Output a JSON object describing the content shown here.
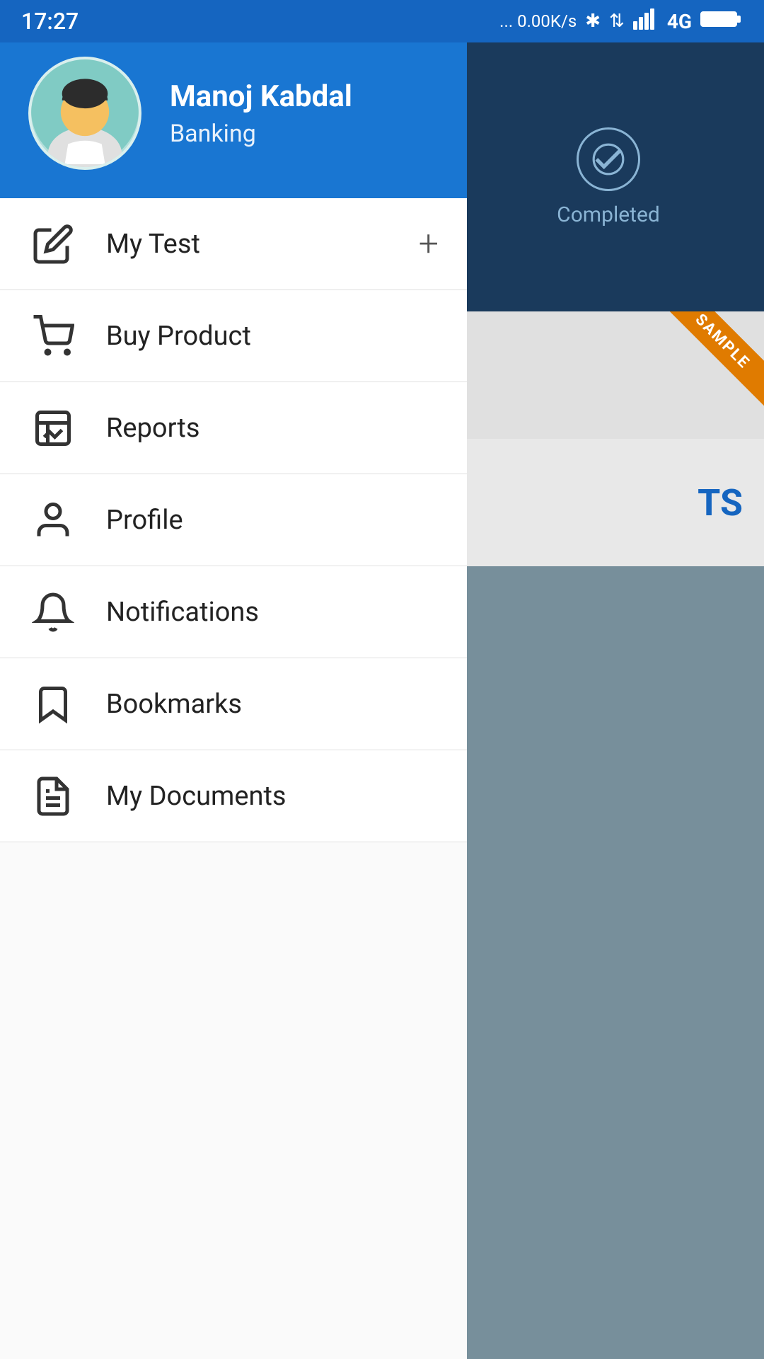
{
  "statusBar": {
    "time": "17:27",
    "network": "... 0.00K/s",
    "signal": "4G"
  },
  "header": {
    "userName": "Manoj Kabdal",
    "userRole": "Banking"
  },
  "completed": {
    "label": "Completed"
  },
  "sampleBadge": {
    "label": "SAMPLE"
  },
  "partialText": "TS",
  "menuItems": [
    {
      "id": "my-test",
      "label": "My Test",
      "hasPlus": true,
      "iconName": "edit-icon"
    },
    {
      "id": "buy-product",
      "label": "Buy Product",
      "hasPlus": false,
      "iconName": "cart-icon"
    },
    {
      "id": "reports",
      "label": "Reports",
      "hasPlus": false,
      "iconName": "chart-icon"
    },
    {
      "id": "profile",
      "label": "Profile",
      "hasPlus": false,
      "iconName": "person-icon"
    },
    {
      "id": "notifications",
      "label": "Notifications",
      "hasPlus": false,
      "iconName": "bell-icon"
    },
    {
      "id": "bookmarks",
      "label": "Bookmarks",
      "hasPlus": false,
      "iconName": "bookmark-icon"
    },
    {
      "id": "my-documents",
      "label": "My Documents",
      "hasPlus": false,
      "iconName": "document-icon"
    }
  ]
}
